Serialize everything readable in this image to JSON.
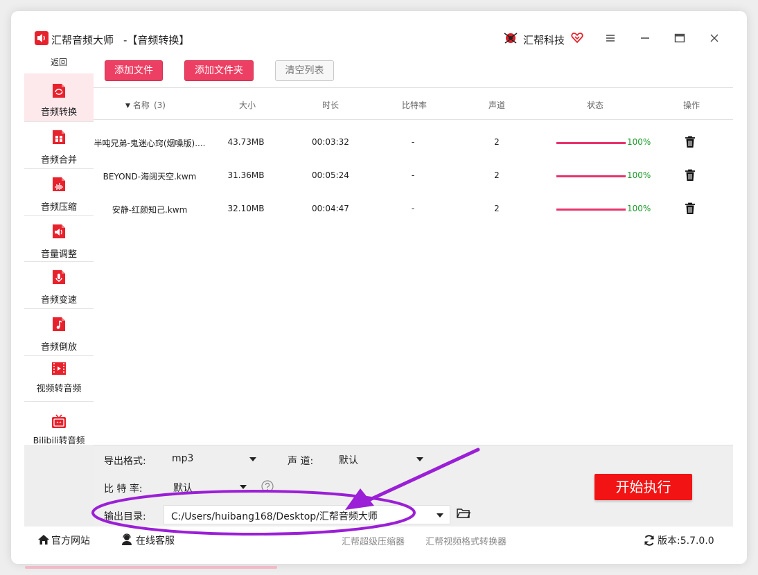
{
  "window": {
    "app_title": "汇帮音频大师",
    "subtitle": "-【音频转换】",
    "brand_name": "汇帮科技"
  },
  "sidebar": {
    "back_label": "返回",
    "items": [
      {
        "label": "音频转换",
        "icon": "audio-convert-icon",
        "active": true
      },
      {
        "label": "音频合并",
        "icon": "audio-merge-icon",
        "active": false
      },
      {
        "label": "音频压缩",
        "icon": "audio-compress-icon",
        "active": false
      },
      {
        "label": "音量调整",
        "icon": "volume-icon",
        "active": false
      },
      {
        "label": "音频变速",
        "icon": "microphone-icon",
        "active": false
      },
      {
        "label": "音频倒放",
        "icon": "music-note-icon",
        "active": false
      },
      {
        "label": "视频转音频",
        "icon": "film-icon",
        "active": false
      },
      {
        "label": "Bilibili转音频",
        "icon": "tv-icon",
        "active": false
      }
    ]
  },
  "toolbar": {
    "add_file": "添加文件",
    "add_folder": "添加文件夹",
    "clear_list": "清空列表"
  },
  "table": {
    "headers": {
      "name": "名称",
      "count": "(3)",
      "size": "大小",
      "duration": "时长",
      "bitrate": "比特率",
      "channel": "声道",
      "status": "状态",
      "operation": "操作"
    },
    "rows": [
      {
        "name": "半吨兄弟-鬼迷心窍(烟嗓版)....",
        "size": "43.73MB",
        "duration": "00:03:32",
        "bitrate": "-",
        "channel": "2",
        "progress": 100,
        "progress_text": "100%"
      },
      {
        "name": "BEYOND-海阔天空.kwm",
        "size": "31.36MB",
        "duration": "00:05:24",
        "bitrate": "-",
        "channel": "2",
        "progress": 100,
        "progress_text": "100%"
      },
      {
        "name": "安静-红颜知己.kwm",
        "size": "32.10MB",
        "duration": "00:04:47",
        "bitrate": "-",
        "channel": "2",
        "progress": 100,
        "progress_text": "100%"
      }
    ]
  },
  "settings": {
    "format_label": "导出格式:",
    "format_value": "mp3",
    "channel_label": "声 道:",
    "channel_value": "默认",
    "bitrate_label": "比 特 率:",
    "bitrate_value": "默认",
    "output_label": "输出目录:",
    "output_value": "C:/Users/huibang168/Desktop/汇帮音频大师",
    "start_button": "开始执行"
  },
  "statusbar": {
    "website": "官方网站",
    "support": "在线客服",
    "link1": "汇帮超级压缩器",
    "link2": "汇帮视频格式转换器",
    "version": "版本:5.7.0.0"
  },
  "colors": {
    "accent": "#ec3f63",
    "start": "#f21414",
    "progress": "#e8336c",
    "progress_text": "#1a9a2a",
    "annotation": "#9b1fd6"
  }
}
